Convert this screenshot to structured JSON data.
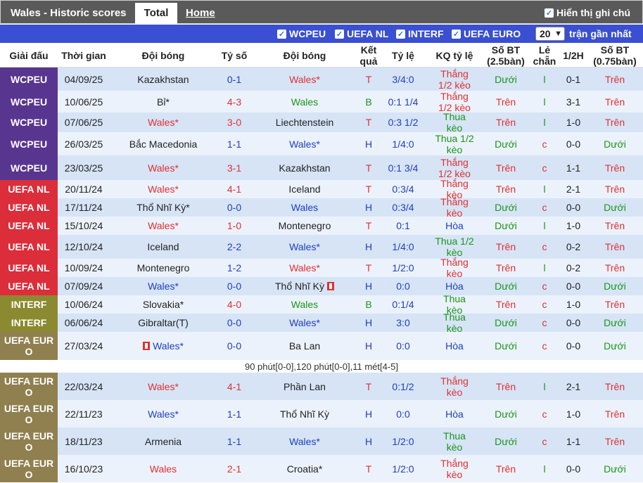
{
  "title": "Wales - Historic scores",
  "tabs": {
    "total": "Total",
    "home": "Home"
  },
  "show_note_label": "Hiển thị ghi chú",
  "filters": [
    {
      "label": "WCPEU",
      "checked": true
    },
    {
      "label": "UEFA NL",
      "checked": true
    },
    {
      "label": "INTERF",
      "checked": true
    },
    {
      "label": "UEFA EURO",
      "checked": true
    }
  ],
  "count_select": "20",
  "recent_label": "trận gần nhất",
  "headers": [
    "Giải đấu",
    "Thời gian",
    "Đội bóng",
    "Tỷ số",
    "Đội bóng",
    "Kết quả",
    "Tỷ lệ",
    "KQ tỷ lệ",
    "Số BT (2.5bàn)",
    "Lẻ chẵn",
    "1/2H",
    "Số BT (0.75bàn)"
  ],
  "colors": {
    "WCPEU": "#58368f",
    "UEFA NL": "#dc2d3a",
    "INTERF": "#8b8a30",
    "UEFA EURO": "#908050",
    "row_even": "#d6e4f6",
    "row_odd": "#ecf2fb"
  },
  "penalty_note": "90 phút[0-0],120 phút[0-0],11 mét[4-5]",
  "matches": [
    {
      "comp": "WCPEU",
      "date": "04/09/25",
      "home": "Kazakhstan",
      "home_color": "dark",
      "score": "0-1",
      "score_color": "blue",
      "away": "Wales*",
      "away_color": "red",
      "result": "T",
      "result_color": "red",
      "odds": "3/4:0",
      "odds_result": "Thắng 1/2 kèo",
      "or_color": "red",
      "ou25": "Dưới",
      "ou25_color": "green",
      "oe": "l",
      "oe_color": "green",
      "half": "0-1",
      "ou075": "Trên",
      "ou075_color": "red"
    },
    {
      "comp": "WCPEU",
      "date": "10/06/25",
      "home": "Bỉ*",
      "home_color": "dark",
      "score": "4-3",
      "score_color": "red",
      "away": "Wales",
      "away_color": "green",
      "result": "B",
      "result_color": "green",
      "odds": "0:1 1/4",
      "odds_result": "Thắng 1/2 kèo",
      "or_color": "red",
      "ou25": "Trên",
      "ou25_color": "red",
      "oe": "l",
      "oe_color": "green",
      "half": "3-1",
      "ou075": "Trên",
      "ou075_color": "red"
    },
    {
      "comp": "WCPEU",
      "date": "07/06/25",
      "home": "Wales*",
      "home_color": "red",
      "score": "3-0",
      "score_color": "red",
      "away": "Liechtenstein",
      "away_color": "dark",
      "result": "T",
      "result_color": "red",
      "odds": "0:3 1/2",
      "odds_result": "Thua kèo",
      "or_color": "green",
      "ou25": "Trên",
      "ou25_color": "red",
      "oe": "l",
      "oe_color": "green",
      "half": "1-0",
      "ou075": "Trên",
      "ou075_color": "red"
    },
    {
      "comp": "WCPEU",
      "date": "26/03/25",
      "home": "Bắc Macedonia",
      "home_color": "dark",
      "score": "1-1",
      "score_color": "blue",
      "away": "Wales*",
      "away_color": "blue",
      "result": "H",
      "result_color": "blue",
      "odds": "1/4:0",
      "odds_result": "Thua 1/2 kèo",
      "or_color": "green",
      "ou25": "Dưới",
      "ou25_color": "green",
      "oe": "c",
      "oe_color": "red",
      "half": "0-0",
      "ou075": "Dưới",
      "ou075_color": "green"
    },
    {
      "comp": "WCPEU",
      "date": "23/03/25",
      "home": "Wales*",
      "home_color": "red",
      "score": "3-1",
      "score_color": "red",
      "away": "Kazakhstan",
      "away_color": "dark",
      "result": "T",
      "result_color": "red",
      "odds": "0:1 3/4",
      "odds_result": "Thắng 1/2 kèo",
      "or_color": "red",
      "ou25": "Trên",
      "ou25_color": "red",
      "oe": "c",
      "oe_color": "red",
      "half": "1-1",
      "ou075": "Trên",
      "ou075_color": "red"
    },
    {
      "comp": "UEFA NL",
      "date": "20/11/24",
      "home": "Wales*",
      "home_color": "red",
      "score": "4-1",
      "score_color": "red",
      "away": "Iceland",
      "away_color": "dark",
      "result": "T",
      "result_color": "red",
      "odds": "0:3/4",
      "odds_result": "Thắng kèo",
      "or_color": "red",
      "ou25": "Trên",
      "ou25_color": "red",
      "oe": "l",
      "oe_color": "green",
      "half": "2-1",
      "ou075": "Trên",
      "ou075_color": "red"
    },
    {
      "comp": "UEFA NL",
      "date": "17/11/24",
      "home": "Thổ Nhĩ Kỳ*",
      "home_color": "dark",
      "score": "0-0",
      "score_color": "blue",
      "away": "Wales",
      "away_color": "blue",
      "result": "H",
      "result_color": "blue",
      "odds": "0:3/4",
      "odds_result": "Thắng kèo",
      "or_color": "red",
      "ou25": "Dưới",
      "ou25_color": "green",
      "oe": "c",
      "oe_color": "red",
      "half": "0-0",
      "ou075": "Dưới",
      "ou075_color": "green"
    },
    {
      "comp": "UEFA NL",
      "date": "15/10/24",
      "home": "Wales*",
      "home_color": "red",
      "score": "1-0",
      "score_color": "red",
      "away": "Montenegro",
      "away_color": "dark",
      "result": "T",
      "result_color": "red",
      "odds": "0:1",
      "odds_result": "Hòa",
      "or_color": "blue",
      "ou25": "Dưới",
      "ou25_color": "green",
      "oe": "l",
      "oe_color": "green",
      "half": "1-0",
      "ou075": "Trên",
      "ou075_color": "red"
    },
    {
      "comp": "UEFA NL",
      "date": "12/10/24",
      "home": "Iceland",
      "home_color": "dark",
      "score": "2-2",
      "score_color": "blue",
      "away": "Wales*",
      "away_color": "blue",
      "result": "H",
      "result_color": "blue",
      "odds": "1/4:0",
      "odds_result": "Thua 1/2 kèo",
      "or_color": "green",
      "ou25": "Trên",
      "ou25_color": "red",
      "oe": "c",
      "oe_color": "red",
      "half": "0-2",
      "ou075": "Trên",
      "ou075_color": "red"
    },
    {
      "comp": "UEFA NL",
      "date": "10/09/24",
      "home": "Montenegro",
      "home_color": "dark",
      "score": "1-2",
      "score_color": "blue",
      "away": "Wales*",
      "away_color": "red",
      "result": "T",
      "result_color": "red",
      "odds": "1/2:0",
      "odds_result": "Thắng kèo",
      "or_color": "red",
      "ou25": "Trên",
      "ou25_color": "red",
      "oe": "l",
      "oe_color": "green",
      "half": "0-2",
      "ou075": "Trên",
      "ou075_color": "red"
    },
    {
      "comp": "UEFA NL",
      "date": "07/09/24",
      "home": "Wales*",
      "home_color": "blue",
      "score": "0-0",
      "score_color": "blue",
      "away": "Thổ Nhĩ Kỳ",
      "away_color": "dark",
      "away_flag": true,
      "result": "H",
      "result_color": "blue",
      "odds": "0:0",
      "odds_result": "Hòa",
      "or_color": "blue",
      "ou25": "Dưới",
      "ou25_color": "green",
      "oe": "c",
      "oe_color": "red",
      "half": "0-0",
      "ou075": "Dưới",
      "ou075_color": "green"
    },
    {
      "comp": "INTERF",
      "date": "10/06/24",
      "home": "Slovakia*",
      "home_color": "dark",
      "score": "4-0",
      "score_color": "red",
      "away": "Wales",
      "away_color": "green",
      "result": "B",
      "result_color": "green",
      "odds": "0:1/4",
      "odds_result": "Thua kèo",
      "or_color": "green",
      "ou25": "Trên",
      "ou25_color": "red",
      "oe": "c",
      "oe_color": "red",
      "half": "1-0",
      "ou075": "Trên",
      "ou075_color": "red"
    },
    {
      "comp": "INTERF",
      "date": "06/06/24",
      "home": "Gibraltar(T)",
      "home_color": "dark",
      "score": "0-0",
      "score_color": "blue",
      "away": "Wales*",
      "away_color": "blue",
      "result": "H",
      "result_color": "blue",
      "odds": "3:0",
      "odds_result": "Thua kèo",
      "or_color": "green",
      "ou25": "Dưới",
      "ou25_color": "green",
      "oe": "c",
      "oe_color": "red",
      "half": "0-0",
      "ou075": "Dưới",
      "ou075_color": "green"
    },
    {
      "comp": "UEFA EURO",
      "date": "27/03/24",
      "home": "Wales*",
      "home_color": "blue",
      "home_flag": true,
      "score": "0-0",
      "score_color": "blue",
      "away": "Ba Lan",
      "away_color": "dark",
      "result": "H",
      "result_color": "blue",
      "odds": "0:0",
      "odds_result": "Hòa",
      "or_color": "blue",
      "ou25": "Dưới",
      "ou25_color": "green",
      "oe": "c",
      "oe_color": "red",
      "half": "0-0",
      "ou075": "Dưới",
      "ou075_color": "green"
    },
    {
      "comp": "UEFA EURO",
      "date": "22/03/24",
      "home": "Wales*",
      "home_color": "red",
      "score": "4-1",
      "score_color": "red",
      "away": "Phần Lan",
      "away_color": "dark",
      "result": "T",
      "result_color": "red",
      "odds": "0:1/2",
      "odds_result": "Thắng kèo",
      "or_color": "red",
      "ou25": "Trên",
      "ou25_color": "red",
      "oe": "l",
      "oe_color": "green",
      "half": "2-1",
      "ou075": "Trên",
      "ou075_color": "red"
    },
    {
      "comp": "UEFA EURO",
      "date": "22/11/23",
      "home": "Wales*",
      "home_color": "blue",
      "score": "1-1",
      "score_color": "blue",
      "away": "Thổ Nhĩ Kỳ",
      "away_color": "dark",
      "result": "H",
      "result_color": "blue",
      "odds": "0:0",
      "odds_result": "Hòa",
      "or_color": "blue",
      "ou25": "Dưới",
      "ou25_color": "green",
      "oe": "c",
      "oe_color": "red",
      "half": "1-0",
      "ou075": "Trên",
      "ou075_color": "red"
    },
    {
      "comp": "UEFA EURO",
      "date": "18/11/23",
      "home": "Armenia",
      "home_color": "dark",
      "score": "1-1",
      "score_color": "blue",
      "away": "Wales*",
      "away_color": "blue",
      "result": "H",
      "result_color": "blue",
      "odds": "1/2:0",
      "odds_result": "Thua kèo",
      "or_color": "green",
      "ou25": "Dưới",
      "ou25_color": "green",
      "oe": "c",
      "oe_color": "red",
      "half": "1-1",
      "ou075": "Trên",
      "ou075_color": "red"
    },
    {
      "comp": "UEFA EURO",
      "date": "16/10/23",
      "home": "Wales",
      "home_color": "red",
      "score": "2-1",
      "score_color": "red",
      "away": "Croatia*",
      "away_color": "dark",
      "result": "T",
      "result_color": "red",
      "odds": "1/2:0",
      "odds_result": "Thắng kèo",
      "or_color": "red",
      "ou25": "Trên",
      "ou25_color": "red",
      "oe": "l",
      "oe_color": "green",
      "half": "0-0",
      "ou075": "Dưới",
      "ou075_color": "green"
    }
  ]
}
